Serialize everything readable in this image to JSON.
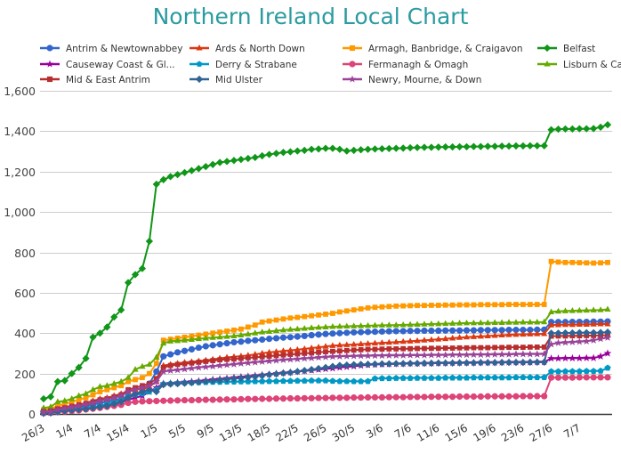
{
  "chart_data": {
    "type": "line",
    "title": "Northern Ireland Local Chart",
    "xlabel": "",
    "ylabel": "",
    "ylim": [
      0,
      1600
    ],
    "yticks": [
      0,
      200,
      400,
      600,
      800,
      1000,
      1200,
      1400,
      1600
    ],
    "ytick_labels": [
      "0",
      "200",
      "400",
      "600",
      "800",
      "1,000",
      "1,200",
      "1,400",
      "1,600"
    ],
    "grid": true,
    "legend_position": "top",
    "xtick_labels": [
      "26/3",
      "1/4",
      "7/4",
      "15/4",
      "1/5",
      "5/5",
      "9/5",
      "13/5",
      "18/5",
      "22/5",
      "26/5",
      "30/5",
      "3/6",
      "7/6",
      "11/6",
      "15/6",
      "19/6",
      "23/6",
      "27/6",
      "7/7"
    ],
    "xtick_every": 4,
    "num_points": 81,
    "series": [
      {
        "name": "Antrim & Newtownabbey",
        "color": "#3366cc",
        "marker": "circle",
        "values": [
          10,
          12,
          20,
          25,
          30,
          35,
          40,
          45,
          55,
          60,
          70,
          75,
          90,
          100,
          110,
          150,
          210,
          285,
          295,
          305,
          312,
          320,
          328,
          335,
          340,
          345,
          350,
          355,
          358,
          362,
          365,
          368,
          372,
          375,
          378,
          380,
          383,
          386,
          390,
          393,
          396,
          398,
          400,
          402,
          404,
          405,
          406,
          407,
          408,
          409,
          410,
          410,
          411,
          411,
          412,
          412,
          412,
          413,
          413,
          413,
          414,
          414,
          415,
          415,
          415,
          415,
          416,
          416,
          416,
          416,
          417,
          417,
          455,
          455,
          455,
          456,
          456,
          456,
          457,
          457,
          458
        ]
      },
      {
        "name": "Ards & North Down",
        "color": "#dc3912",
        "marker": "triangle",
        "values": [
          15,
          18,
          30,
          35,
          40,
          45,
          55,
          65,
          75,
          80,
          90,
          100,
          110,
          120,
          125,
          135,
          160,
          240,
          245,
          250,
          255,
          258,
          262,
          266,
          270,
          275,
          280,
          283,
          286,
          290,
          295,
          300,
          305,
          308,
          312,
          315,
          318,
          322,
          326,
          330,
          334,
          338,
          340,
          342,
          344,
          346,
          348,
          350,
          352,
          354,
          356,
          358,
          360,
          362,
          365,
          367,
          370,
          372,
          375,
          378,
          380,
          382,
          384,
          386,
          388,
          390,
          392,
          393,
          394,
          395,
          396,
          397,
          440,
          441,
          442,
          442,
          443,
          443,
          444,
          445,
          445
        ]
      },
      {
        "name": "Armagh, Banbridge, & Craigavon",
        "color": "#ff9900",
        "marker": "square",
        "values": [
          20,
          25,
          40,
          50,
          60,
          70,
          80,
          95,
          110,
          120,
          130,
          140,
          160,
          170,
          180,
          200,
          250,
          365,
          370,
          375,
          380,
          385,
          390,
          395,
          400,
          405,
          410,
          415,
          420,
          430,
          440,
          455,
          460,
          465,
          470,
          475,
          478,
          482,
          486,
          490,
          494,
          498,
          505,
          510,
          515,
          520,
          525,
          528,
          530,
          532,
          534,
          535,
          536,
          537,
          537,
          538,
          538,
          539,
          539,
          540,
          540,
          540,
          541,
          541,
          541,
          541,
          542,
          542,
          542,
          542,
          542,
          542,
          755,
          752,
          750,
          750,
          749,
          748,
          747,
          748,
          750
        ]
      },
      {
        "name": "Belfast",
        "color": "#109618",
        "marker": "diamond",
        "values": [
          75,
          85,
          160,
          165,
          200,
          230,
          275,
          380,
          400,
          430,
          480,
          515,
          650,
          690,
          720,
          855,
          1137,
          1160,
          1175,
          1185,
          1195,
          1205,
          1215,
          1225,
          1235,
          1245,
          1250,
          1255,
          1260,
          1265,
          1270,
          1278,
          1285,
          1290,
          1295,
          1298,
          1302,
          1305,
          1310,
          1312,
          1315,
          1315,
          1310,
          1302,
          1305,
          1308,
          1310,
          1312,
          1313,
          1314,
          1315,
          1316,
          1318,
          1319,
          1320,
          1320,
          1321,
          1322,
          1322,
          1323,
          1323,
          1324,
          1324,
          1325,
          1325,
          1326,
          1326,
          1327,
          1327,
          1328,
          1328,
          1328,
          1407,
          1410,
          1411,
          1411,
          1412,
          1412,
          1413,
          1420,
          1432
        ]
      },
      {
        "name": "Causeway Coast & Gl...",
        "color": "#990099",
        "marker": "star",
        "values": [
          5,
          6,
          10,
          15,
          18,
          22,
          26,
          30,
          35,
          40,
          45,
          55,
          70,
          80,
          90,
          110,
          130,
          150,
          152,
          155,
          158,
          160,
          163,
          166,
          170,
          173,
          176,
          180,
          183,
          186,
          190,
          193,
          196,
          200,
          203,
          206,
          210,
          213,
          216,
          220,
          223,
          226,
          230,
          233,
          236,
          240,
          243,
          245,
          246,
          247,
          248,
          249,
          250,
          250,
          251,
          251,
          252,
          252,
          253,
          253,
          254,
          254,
          255,
          255,
          255,
          255,
          256,
          256,
          256,
          256,
          257,
          257,
          275,
          275,
          276,
          276,
          276,
          277,
          277,
          285,
          300
        ]
      },
      {
        "name": "Derry & Strabane",
        "color": "#0099c6",
        "marker": "pentagon",
        "values": [
          8,
          10,
          15,
          18,
          22,
          26,
          30,
          35,
          40,
          50,
          60,
          70,
          85,
          95,
          100,
          110,
          120,
          148,
          150,
          152,
          154,
          155,
          156,
          157,
          158,
          158,
          159,
          159,
          160,
          160,
          161,
          161,
          162,
          162,
          163,
          163,
          164,
          164,
          165,
          165,
          165,
          163,
          162,
          162,
          161,
          161,
          162,
          175,
          176,
          176,
          177,
          177,
          177,
          178,
          178,
          178,
          178,
          179,
          179,
          179,
          179,
          180,
          180,
          180,
          180,
          180,
          180,
          181,
          181,
          181,
          181,
          181,
          210,
          210,
          211,
          211,
          211,
          212,
          212,
          213,
          228
        ]
      },
      {
        "name": "Fermanagh & Omagh",
        "color": "#dd4477",
        "marker": "circle",
        "values": [
          5,
          6,
          10,
          12,
          15,
          18,
          22,
          26,
          30,
          35,
          40,
          45,
          55,
          60,
          62,
          63,
          64,
          65,
          66,
          67,
          68,
          68,
          69,
          70,
          70,
          71,
          72,
          72,
          73,
          74,
          74,
          75,
          75,
          76,
          76,
          77,
          77,
          78,
          78,
          79,
          79,
          80,
          80,
          80,
          81,
          81,
          82,
          82,
          82,
          83,
          83,
          83,
          84,
          84,
          84,
          85,
          85,
          85,
          85,
          86,
          86,
          86,
          86,
          87,
          87,
          87,
          87,
          87,
          88,
          88,
          88,
          88,
          180,
          180,
          180,
          180,
          181,
          181,
          181,
          181,
          181
        ]
      },
      {
        "name": "Lisburn & Castlereagh",
        "color": "#66aa00",
        "marker": "triangle",
        "values": [
          30,
          35,
          60,
          65,
          75,
          90,
          100,
          120,
          135,
          140,
          150,
          160,
          180,
          220,
          235,
          245,
          280,
          350,
          360,
          362,
          365,
          368,
          372,
          375,
          378,
          380,
          383,
          386,
          390,
          395,
          400,
          405,
          408,
          412,
          415,
          418,
          420,
          423,
          426,
          428,
          430,
          432,
          433,
          434,
          435,
          436,
          437,
          438,
          439,
          440,
          440,
          441,
          442,
          443,
          444,
          445,
          446,
          447,
          448,
          449,
          450,
          450,
          451,
          451,
          452,
          452,
          453,
          453,
          454,
          454,
          454,
          455,
          505,
          508,
          510,
          511,
          512,
          513,
          514,
          515,
          518
        ]
      },
      {
        "name": "Mid & East Antrim",
        "color": "#b82e2e",
        "marker": "square",
        "values": [
          12,
          15,
          25,
          30,
          38,
          45,
          52,
          60,
          70,
          75,
          85,
          95,
          120,
          130,
          140,
          150,
          175,
          230,
          240,
          245,
          248,
          252,
          256,
          260,
          264,
          268,
          270,
          272,
          275,
          278,
          280,
          283,
          286,
          289,
          292,
          295,
          297,
          300,
          302,
          305,
          308,
          310,
          312,
          314,
          316,
          318,
          320,
          320,
          321,
          322,
          322,
          323,
          323,
          324,
          324,
          325,
          325,
          326,
          326,
          327,
          327,
          328,
          328,
          328,
          329,
          329,
          330,
          330,
          330,
          331,
          331,
          331,
          385,
          386,
          386,
          387,
          387,
          388,
          388,
          389,
          390
        ]
      },
      {
        "name": "Mid Ulster",
        "color": "#316395",
        "marker": "diamond",
        "values": [
          3,
          5,
          10,
          15,
          18,
          22,
          25,
          30,
          35,
          40,
          50,
          60,
          80,
          100,
          110,
          120,
          110,
          145,
          148,
          150,
          152,
          155,
          158,
          162,
          165,
          168,
          172,
          175,
          178,
          182,
          185,
          190,
          195,
          198,
          202,
          205,
          210,
          215,
          220,
          225,
          230,
          235,
          240,
          242,
          244,
          245,
          246,
          247,
          248,
          248,
          249,
          249,
          250,
          250,
          251,
          251,
          252,
          252,
          252,
          253,
          253,
          253,
          254,
          254,
          254,
          255,
          255,
          255,
          255,
          256,
          256,
          256,
          400,
          400,
          401,
          401,
          402,
          402,
          402,
          403,
          405
        ]
      },
      {
        "name": "Newry, Mourne, & Down",
        "color": "#994499",
        "marker": "star",
        "values": [
          10,
          12,
          22,
          28,
          34,
          40,
          48,
          55,
          65,
          72,
          80,
          90,
          110,
          120,
          130,
          140,
          160,
          210,
          215,
          218,
          222,
          226,
          230,
          233,
          236,
          240,
          243,
          246,
          250,
          253,
          256,
          259,
          262,
          265,
          268,
          270,
          272,
          275,
          277,
          280,
          282,
          284,
          285,
          286,
          287,
          288,
          288,
          289,
          289,
          290,
          290,
          290,
          291,
          291,
          291,
          292,
          292,
          292,
          293,
          293,
          293,
          294,
          294,
          294,
          295,
          295,
          295,
          296,
          296,
          296,
          296,
          297,
          345,
          352,
          354,
          356,
          358,
          360,
          365,
          372,
          378
        ]
      }
    ]
  }
}
